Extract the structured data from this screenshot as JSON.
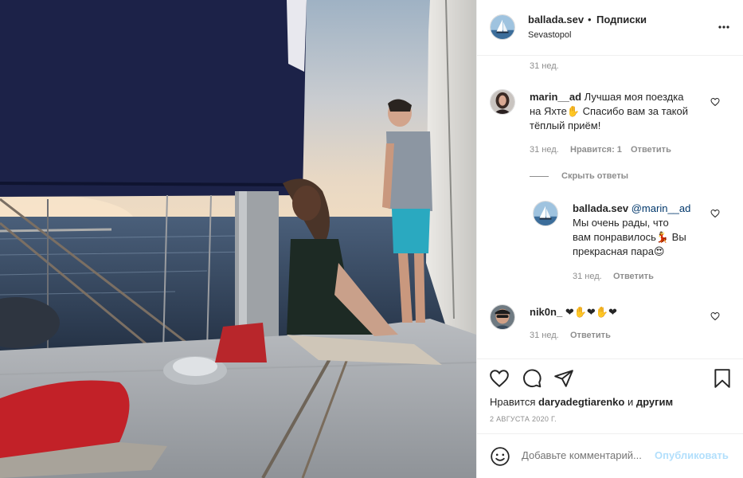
{
  "header": {
    "username": "ballada.sev",
    "dot": "•",
    "follow_label": "Подписки",
    "location": "Sevastopol",
    "more_icon": "more-horizontal-icon"
  },
  "comments": {
    "caption_time": "31 нед.",
    "items": [
      {
        "username": "marin__ad",
        "text_lines": [
          "Лучшая моя поездка",
          "на Яхте✋ Спасибо вам за такой",
          "тёплый приём!"
        ],
        "time": "31 нед.",
        "likes": "Нравится: 1",
        "reply_label": "Ответить",
        "hide_replies": "Скрыть ответы"
      },
      {
        "username": "ballada.sev",
        "mention": "@marin__ad",
        "text_lines": [
          "Мы очень рады, что",
          "вам понравилось💃 Вы",
          "прекрасная пара😍"
        ],
        "time": "31 нед.",
        "reply_label": "Ответить"
      },
      {
        "username": "nik0n_",
        "text": "❤✋❤✋❤",
        "time": "31 нед.",
        "reply_label": "Ответить"
      }
    ]
  },
  "actions": {
    "icons": [
      "heart-icon",
      "comment-icon",
      "share-icon",
      "bookmark-icon"
    ],
    "likes_prefix": "Нравится ",
    "likes_user": "daryadegtiarenko",
    "likes_and": " и ",
    "likes_others": "другим",
    "date": "2 АВГУСТА 2020 Г."
  },
  "add_comment": {
    "placeholder": "Добавьте комментарий...",
    "publish_label": "Опубликовать",
    "emoji_icon": "smiley-icon"
  },
  "colors": {
    "text": "#262626",
    "secondary": "#8e8e8e",
    "publish_disabled": "#b2dffc",
    "mention": "#00376b",
    "border": "#efefef",
    "sail_navy": "#1c2248"
  }
}
